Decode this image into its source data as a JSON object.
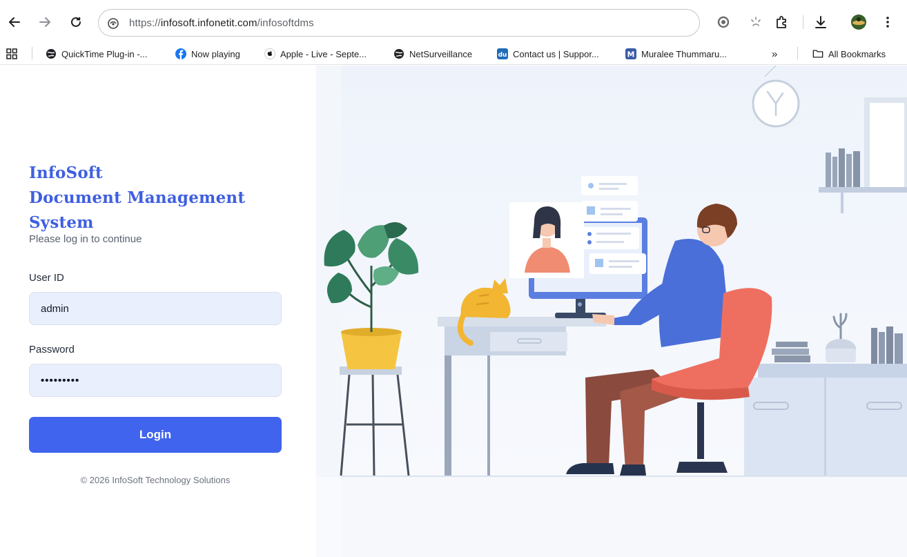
{
  "browser": {
    "url_prefix": "https://",
    "url_host": "infosoft.infonetit.com",
    "url_path": "/infosoftdms",
    "bookmarks": [
      {
        "label": "QuickTime Plug-in -...",
        "icon": "globe-icon"
      },
      {
        "label": "Now playing",
        "icon": "facebook-icon"
      },
      {
        "label": "Apple - Live - Septe...",
        "icon": "apple-icon"
      },
      {
        "label": "NetSurveillance",
        "icon": "globe-icon"
      },
      {
        "label": "Contact us | Suppor...",
        "icon": "du-icon"
      },
      {
        "label": "Muralee Thummaru...",
        "icon": "m-icon"
      }
    ],
    "overflow_label": "»",
    "all_bookmarks_label": "All Bookmarks"
  },
  "login": {
    "title_line1": "InfoSoft",
    "title_line2": "Document Management",
    "title_line3": "System",
    "subtitle": "Please log in to continue",
    "user_id_label": "User ID",
    "user_id_value": "admin",
    "password_label": "Password",
    "password_value": "•••••••••",
    "login_button": "Login",
    "footer": "© 2026 InfoSoft Technology Solutions"
  },
  "colors": {
    "accent": "#4064ed",
    "title": "#3f5fe0",
    "input_bg": "#e9effd"
  }
}
